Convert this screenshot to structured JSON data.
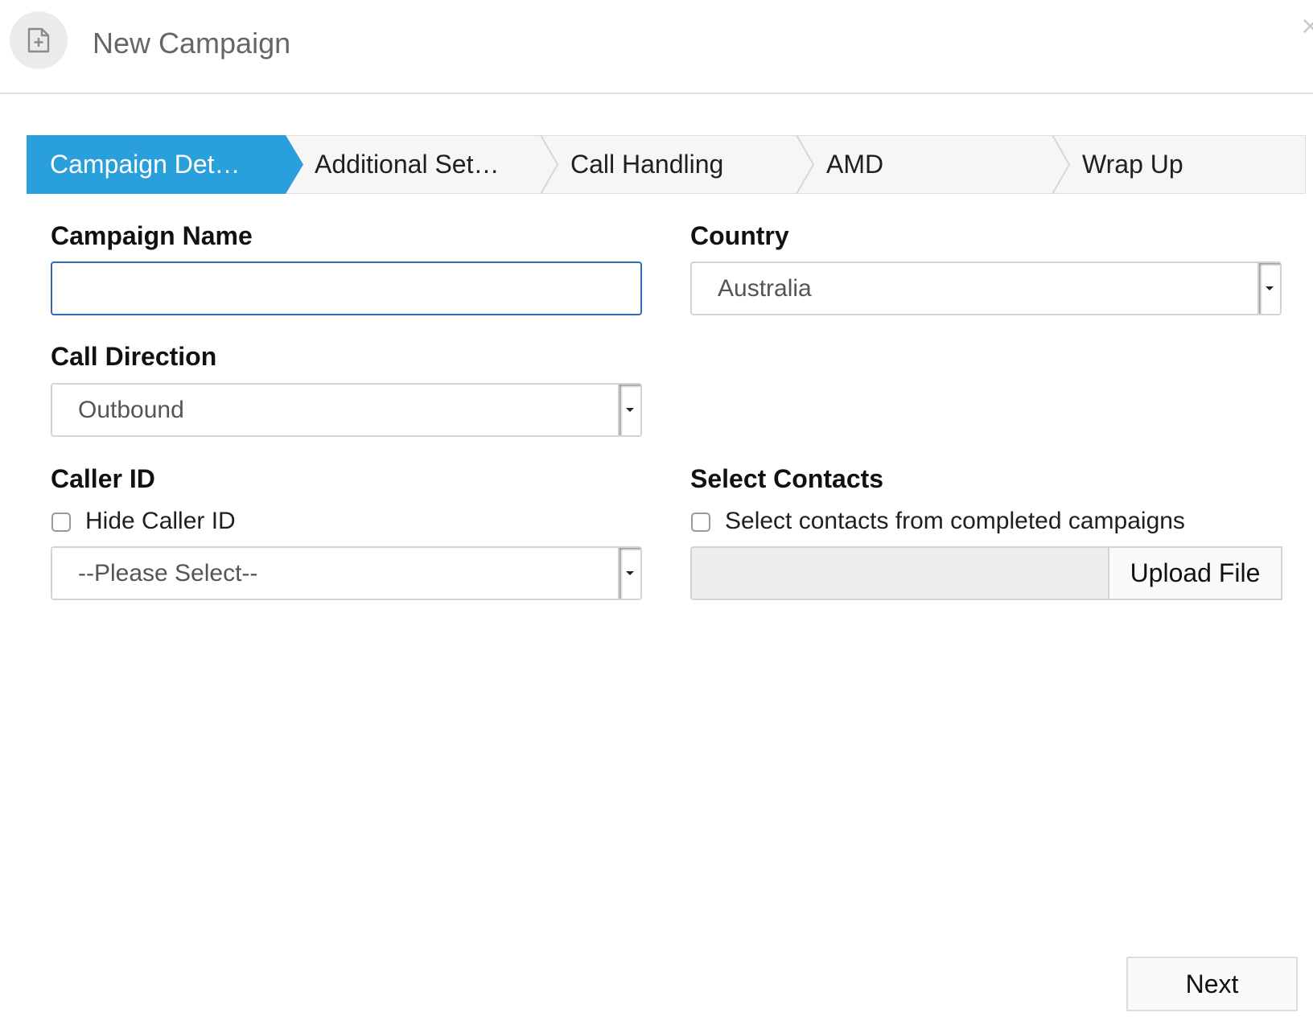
{
  "header": {
    "title": "New Campaign",
    "icon": "new-document-icon"
  },
  "wizard": {
    "accent_color": "#29a0dc",
    "steps": [
      {
        "label": "Campaign Det…",
        "active": true
      },
      {
        "label": "Additional Set…",
        "active": false
      },
      {
        "label": "Call Handling",
        "active": false
      },
      {
        "label": "AMD",
        "active": false
      },
      {
        "label": "Wrap Up",
        "active": false
      }
    ]
  },
  "form": {
    "campaign_name": {
      "label": "Campaign Name",
      "value": "",
      "placeholder": ""
    },
    "country": {
      "label": "Country",
      "value": "Australia"
    },
    "call_direction": {
      "label": "Call Direction",
      "value": "Outbound"
    },
    "caller_id": {
      "label": "Caller ID",
      "hide_label": "Hide Caller ID",
      "hide_checked": false,
      "value": "--Please Select--"
    },
    "select_contacts": {
      "label": "Select Contacts",
      "checkbox_label": "Select contacts from completed campaigns",
      "checked": false,
      "upload_label": "Upload File"
    }
  },
  "footer": {
    "next_label": "Next"
  }
}
